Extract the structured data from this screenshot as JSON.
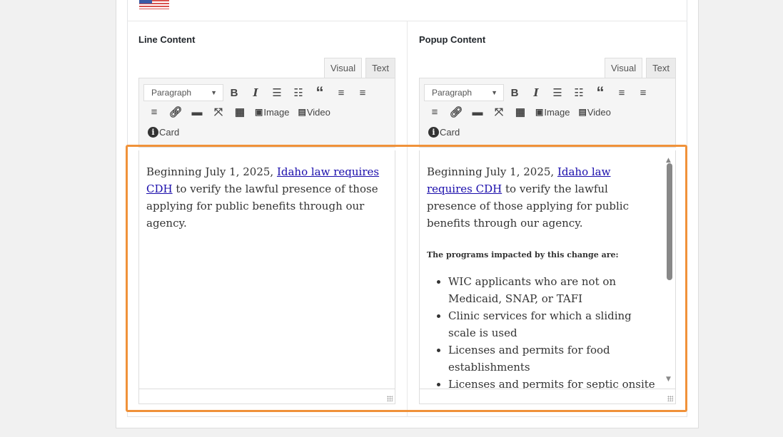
{
  "left": {
    "label": "Line Content",
    "tabs": [
      "Visual",
      "Text"
    ],
    "format": "Paragraph",
    "image": "Image",
    "video": "Video",
    "card": "Card",
    "text_before": "Beginning July 1, 2025, ",
    "link": "Idaho law requires CDH",
    "text_after": " to verify the lawful presence of those applying for public benefits through our agency."
  },
  "right": {
    "label": "Popup Content",
    "tabs": [
      "Visual",
      "Text"
    ],
    "format": "Paragraph",
    "image": "Image",
    "video": "Video",
    "card": "Card",
    "text_before": "Beginning July 1, 2025, ",
    "link": "Idaho law requires CDH",
    "text_after": " to verify the lawful presence of those applying for public benefits through our agency.",
    "heading": "The programs impacted by this change are:",
    "items": [
      "WIC applicants who are not on Medicaid, SNAP, or TAFI",
      "Clinic services for which a sliding scale is used",
      "Licenses and permits for food establishments",
      "Licenses and permits for septic onsite"
    ]
  },
  "highlight_color": "#f0923a"
}
